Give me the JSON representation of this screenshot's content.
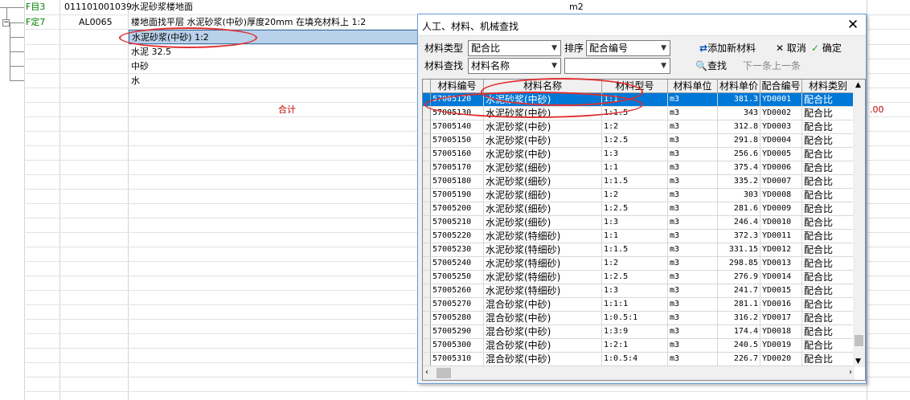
{
  "background": {
    "rows": [
      {
        "type": "F目3",
        "code": "011101001039",
        "name": "水泥砂浆楼地面",
        "unit": "m2"
      },
      {
        "type": "F定7",
        "code": "AL0065",
        "name": "楼地面找平层 水泥砂浆(中砂)厚度20mm 在填充材料上 1:2"
      }
    ],
    "sub_items": [
      "水泥砂浆(中砂) 1:2",
      "水泥 32.5",
      "中砂",
      "水"
    ],
    "total_label": "合计",
    "right_value": ".00"
  },
  "dialog": {
    "title": "人工、材料、机械查找",
    "close_glyph": "✕",
    "material_type_label": "材料类型",
    "material_type_value": "配合比",
    "sort_label": "排序",
    "sort_value": "配合编号",
    "add_button": "添加新材料",
    "cancel_button": "取消",
    "ok_button": "确定",
    "search_label": "材料查找",
    "search_field_value": "材料名称",
    "search_text_value": "",
    "find_button": "查找",
    "next_button": "下一条",
    "prev_button": "上一条",
    "columns": [
      "材料编号",
      "材料名称",
      "材料型号",
      "材料单位",
      "材料单价",
      "配合编号",
      "材料类别"
    ],
    "selected_row": 0,
    "rows": [
      {
        "code": "57005120",
        "name": "水泥砂浆(中砂)",
        "model": "1:1",
        "unit": "m3",
        "price": "381.3",
        "mix": "YD0001",
        "cat": "配合比"
      },
      {
        "code": "57005130",
        "name": "水泥砂浆(中砂)",
        "model": "1:1.5",
        "unit": "m3",
        "price": "343",
        "mix": "YD0002",
        "cat": "配合比"
      },
      {
        "code": "57005140",
        "name": "水泥砂浆(中砂)",
        "model": "1:2",
        "unit": "m3",
        "price": "312.8",
        "mix": "YD0003",
        "cat": "配合比"
      },
      {
        "code": "57005150",
        "name": "水泥砂浆(中砂)",
        "model": "1:2.5",
        "unit": "m3",
        "price": "291.8",
        "mix": "YD0004",
        "cat": "配合比"
      },
      {
        "code": "57005160",
        "name": "水泥砂浆(中砂)",
        "model": "1:3",
        "unit": "m3",
        "price": "256.6",
        "mix": "YD0005",
        "cat": "配合比"
      },
      {
        "code": "57005170",
        "name": "水泥砂浆(细砂)",
        "model": "1:1",
        "unit": "m3",
        "price": "375.4",
        "mix": "YD0006",
        "cat": "配合比"
      },
      {
        "code": "57005180",
        "name": "水泥砂浆(细砂)",
        "model": "1:1.5",
        "unit": "m3",
        "price": "335.2",
        "mix": "YD0007",
        "cat": "配合比"
      },
      {
        "code": "57005190",
        "name": "水泥砂浆(细砂)",
        "model": "1:2",
        "unit": "m3",
        "price": "303",
        "mix": "YD0008",
        "cat": "配合比"
      },
      {
        "code": "57005200",
        "name": "水泥砂浆(细砂)",
        "model": "1:2.5",
        "unit": "m3",
        "price": "281.6",
        "mix": "YD0009",
        "cat": "配合比"
      },
      {
        "code": "57005210",
        "name": "水泥砂浆(细砂)",
        "model": "1:3",
        "unit": "m3",
        "price": "246.4",
        "mix": "YD0010",
        "cat": "配合比"
      },
      {
        "code": "57005220",
        "name": "水泥砂浆(特细砂)",
        "model": "1:1",
        "unit": "m3",
        "price": "372.3",
        "mix": "YD0011",
        "cat": "配合比"
      },
      {
        "code": "57005230",
        "name": "水泥砂浆(特细砂)",
        "model": "1:1.5",
        "unit": "m3",
        "price": "331.15",
        "mix": "YD0012",
        "cat": "配合比"
      },
      {
        "code": "57005240",
        "name": "水泥砂浆(特细砂)",
        "model": "1:2",
        "unit": "m3",
        "price": "298.85",
        "mix": "YD0013",
        "cat": "配合比"
      },
      {
        "code": "57005250",
        "name": "水泥砂浆(特细砂)",
        "model": "1:2.5",
        "unit": "m3",
        "price": "276.9",
        "mix": "YD0014",
        "cat": "配合比"
      },
      {
        "code": "57005260",
        "name": "水泥砂浆(特细砂)",
        "model": "1:3",
        "unit": "m3",
        "price": "241.7",
        "mix": "YD0015",
        "cat": "配合比"
      },
      {
        "code": "57005270",
        "name": "混合砂浆(中砂)",
        "model": "1:1:1",
        "unit": "m3",
        "price": "281.1",
        "mix": "YD0016",
        "cat": "配合比"
      },
      {
        "code": "57005280",
        "name": "混合砂浆(中砂)",
        "model": "1:0.5:1",
        "unit": "m3",
        "price": "316.2",
        "mix": "YD0017",
        "cat": "配合比"
      },
      {
        "code": "57005290",
        "name": "混合砂浆(中砂)",
        "model": "1:3:9",
        "unit": "m3",
        "price": "174.4",
        "mix": "YD0018",
        "cat": "配合比"
      },
      {
        "code": "57005300",
        "name": "混合砂浆(中砂)",
        "model": "1:2:1",
        "unit": "m3",
        "price": "240.5",
        "mix": "YD0019",
        "cat": "配合比"
      },
      {
        "code": "57005310",
        "name": "混合砂浆(中砂)",
        "model": "1:0.5:4",
        "unit": "m3",
        "price": "226.7",
        "mix": "YD0020",
        "cat": "配合比"
      }
    ]
  },
  "colors": {
    "accent": "#0078d7",
    "annotation": "#e03030",
    "total_text": "#c00000",
    "tree_label": "#008000"
  }
}
